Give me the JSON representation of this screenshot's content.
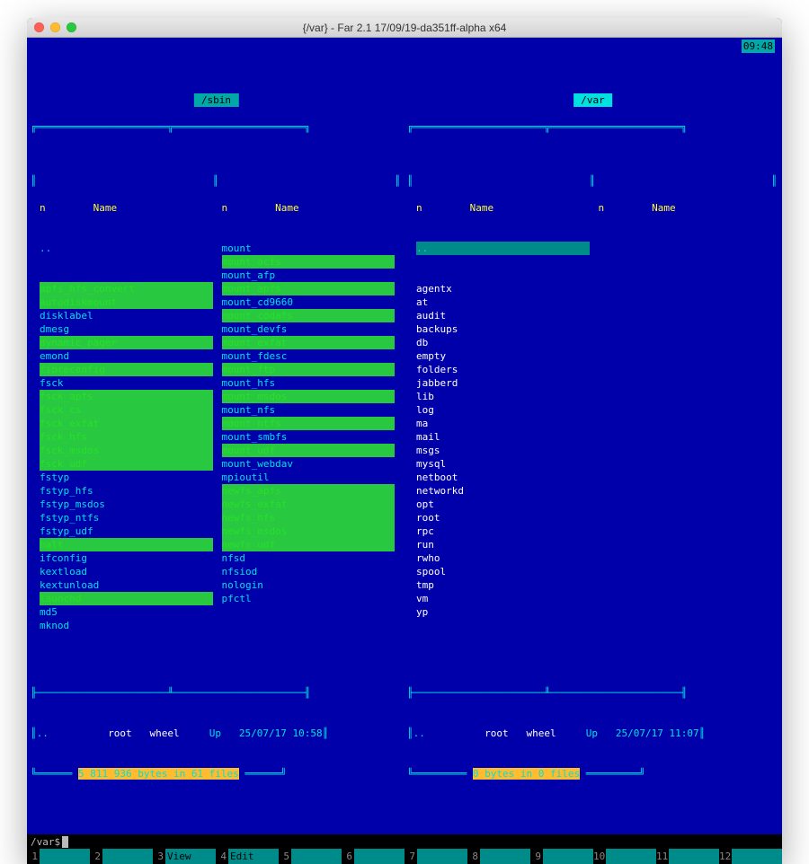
{
  "window_title": "{/var} - Far 2.1 17/09/19-da351ff-alpha x64",
  "clock": "09:48",
  "left": {
    "path": "/sbin",
    "col_header_n": "n",
    "col_header_name": "Name",
    "up": "..",
    "col1": [
      {
        "t": "apfs_hfs_convert",
        "c": "green"
      },
      {
        "t": "autodiskmount",
        "c": "green"
      },
      {
        "t": "disklabel",
        "c": "cyan"
      },
      {
        "t": "dmesg",
        "c": "cyan"
      },
      {
        "t": "dynamic_pager",
        "c": "green"
      },
      {
        "t": "emond",
        "c": "cyan"
      },
      {
        "t": "fibreconfig",
        "c": "green"
      },
      {
        "t": "fsck",
        "c": "cyan"
      },
      {
        "t": "fsck_apfs",
        "c": "green"
      },
      {
        "t": "fsck_cs",
        "c": "green"
      },
      {
        "t": "fsck_exfat",
        "c": "green"
      },
      {
        "t": "fsck_hfs",
        "c": "green"
      },
      {
        "t": "fsck_msdos",
        "c": "green"
      },
      {
        "t": "fsck_udf",
        "c": "green"
      },
      {
        "t": "fstyp",
        "c": "cyan"
      },
      {
        "t": "fstyp_hfs",
        "c": "cyan"
      },
      {
        "t": "fstyp_msdos",
        "c": "cyan"
      },
      {
        "t": "fstyp_ntfs",
        "c": "cyan"
      },
      {
        "t": "fstyp_udf",
        "c": "cyan"
      },
      {
        "t": "halt",
        "c": "green"
      },
      {
        "t": "ifconfig",
        "c": "cyan"
      },
      {
        "t": "kextload",
        "c": "cyan"
      },
      {
        "t": "kextunload",
        "c": "cyan"
      },
      {
        "t": "launchd",
        "c": "green"
      },
      {
        "t": "md5",
        "c": "cyan"
      },
      {
        "t": "mknod",
        "c": "cyan"
      }
    ],
    "col2": [
      {
        "t": "mount",
        "c": "cyan"
      },
      {
        "t": "mount_acfs",
        "c": "green"
      },
      {
        "t": "mount_afp",
        "c": "cyan"
      },
      {
        "t": "mount_apfs",
        "c": "green"
      },
      {
        "t": "mount_cd9660",
        "c": "cyan"
      },
      {
        "t": "mount_cddafs",
        "c": "green"
      },
      {
        "t": "mount_devfs",
        "c": "cyan"
      },
      {
        "t": "mount_exfat",
        "c": "green"
      },
      {
        "t": "mount_fdesc",
        "c": "cyan"
      },
      {
        "t": "mount_ftp",
        "c": "green"
      },
      {
        "t": "mount_hfs",
        "c": "cyan"
      },
      {
        "t": "mount_msdos",
        "c": "green"
      },
      {
        "t": "mount_nfs",
        "c": "cyan"
      },
      {
        "t": "mount_ntfs",
        "c": "green"
      },
      {
        "t": "mount_smbfs",
        "c": "cyan"
      },
      {
        "t": "mount_udf",
        "c": "green"
      },
      {
        "t": "mount_webdav",
        "c": "cyan"
      },
      {
        "t": "mpioutil",
        "c": "cyan"
      },
      {
        "t": "newfs_apfs",
        "c": "green"
      },
      {
        "t": "newfs_exfat",
        "c": "green"
      },
      {
        "t": "newfs_hfs",
        "c": "green"
      },
      {
        "t": "newfs_msdos",
        "c": "green"
      },
      {
        "t": "newfs_udf",
        "c": "green"
      },
      {
        "t": "nfsd",
        "c": "cyan"
      },
      {
        "t": "nfsiod",
        "c": "cyan"
      },
      {
        "t": "nologin",
        "c": "cyan"
      },
      {
        "t": "pfctl",
        "c": "cyan"
      }
    ],
    "status_sel": "..",
    "status_owner": "root",
    "status_group": "wheel",
    "status_link": "Up",
    "status_date": "25/07/17",
    "status_time": "10:58",
    "summary": "5 811 936 bytes in 61 files"
  },
  "right": {
    "path": "/var",
    "col_header_n": "n",
    "col_header_name": "Name",
    "up": "..",
    "col1": [
      {
        "t": "agentx",
        "c": "white"
      },
      {
        "t": "at",
        "c": "white"
      },
      {
        "t": "audit",
        "c": "white"
      },
      {
        "t": "backups",
        "c": "white"
      },
      {
        "t": "db",
        "c": "white"
      },
      {
        "t": "empty",
        "c": "white"
      },
      {
        "t": "folders",
        "c": "white"
      },
      {
        "t": "jabberd",
        "c": "white"
      },
      {
        "t": "lib",
        "c": "white"
      },
      {
        "t": "log",
        "c": "white"
      },
      {
        "t": "ma",
        "c": "white"
      },
      {
        "t": "mail",
        "c": "white"
      },
      {
        "t": "msgs",
        "c": "white"
      },
      {
        "t": "mysql",
        "c": "white"
      },
      {
        "t": "netboot",
        "c": "white"
      },
      {
        "t": "networkd",
        "c": "white"
      },
      {
        "t": "opt",
        "c": "white"
      },
      {
        "t": "root",
        "c": "white"
      },
      {
        "t": "rpc",
        "c": "white"
      },
      {
        "t": "run",
        "c": "white"
      },
      {
        "t": "rwho",
        "c": "white"
      },
      {
        "t": "spool",
        "c": "white"
      },
      {
        "t": "tmp",
        "c": "white"
      },
      {
        "t": "vm",
        "c": "white"
      },
      {
        "t": "yp",
        "c": "white"
      }
    ],
    "col2": [],
    "status_sel": "..",
    "status_owner": "root",
    "status_group": "wheel",
    "status_link": "Up",
    "status_date": "25/07/17",
    "status_time": "11:07",
    "summary": "0 bytes in 0 files"
  },
  "cmdline_path": "/var",
  "cmdline_prompt": "$",
  "keybar": [
    {
      "n": "1",
      "l": ""
    },
    {
      "n": "2",
      "l": ""
    },
    {
      "n": "3",
      "l": "View"
    },
    {
      "n": "4",
      "l": "Edit"
    },
    {
      "n": "5",
      "l": ""
    },
    {
      "n": "6",
      "l": ""
    },
    {
      "n": "7",
      "l": ""
    },
    {
      "n": "8",
      "l": ""
    },
    {
      "n": "9",
      "l": ""
    },
    {
      "n": "10",
      "l": ""
    },
    {
      "n": "11",
      "l": ""
    },
    {
      "n": "12",
      "l": ""
    }
  ]
}
